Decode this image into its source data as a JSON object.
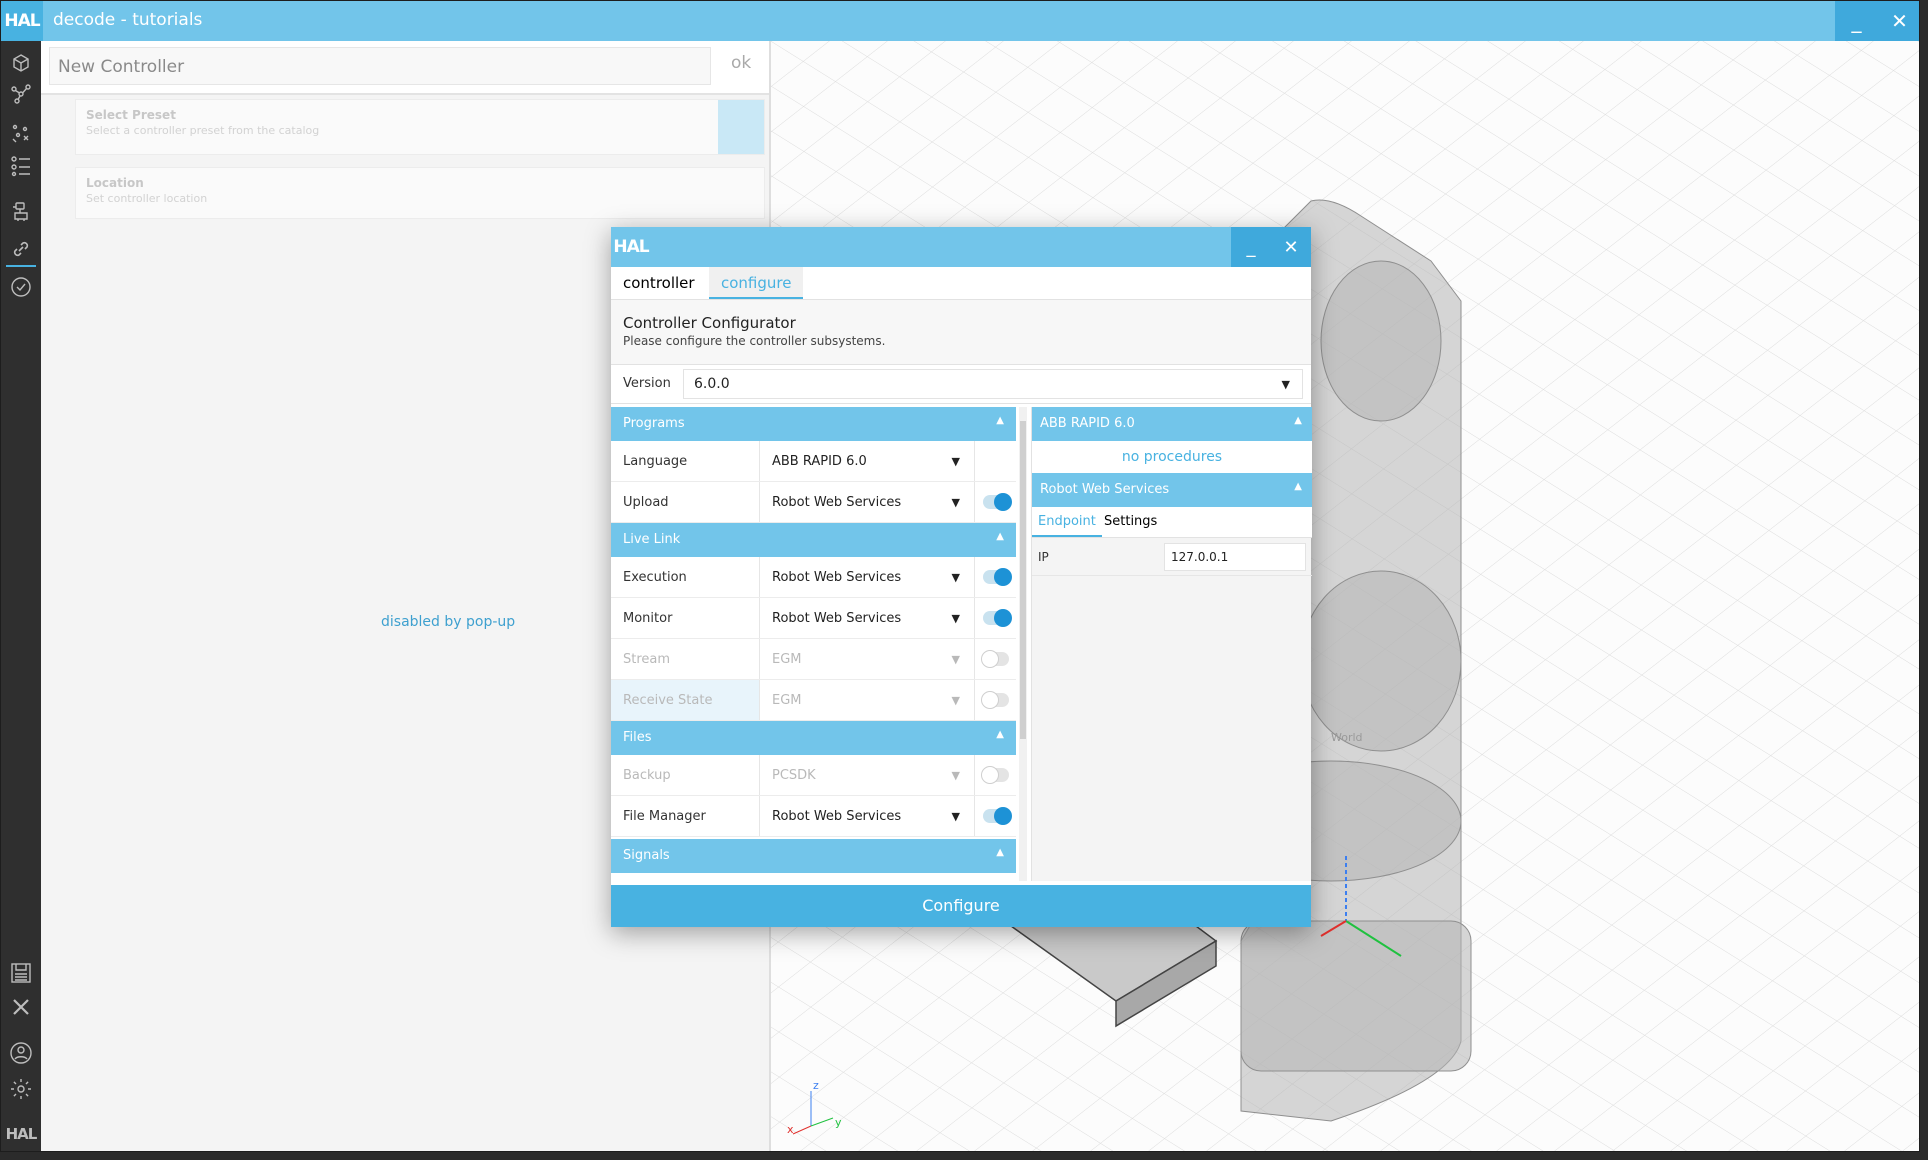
{
  "app": {
    "logo": "HAL",
    "title": "decode - tutorials",
    "minimize": "_",
    "close": "✕"
  },
  "sidebar": {
    "logo": "HAL",
    "icons": [
      "cube-icon",
      "graph-nodes-icon",
      "scatter-icon",
      "list-icon",
      "robot-icon",
      "link-icon",
      "check-circle-icon",
      "save-icon",
      "close-icon",
      "user-icon",
      "settings-icon"
    ]
  },
  "left_panel": {
    "name_placeholder": "New Controller",
    "ok_label": "ok",
    "cards": [
      {
        "title": "Select Preset",
        "subtitle": "Select a controller preset from the catalog"
      },
      {
        "title": "Location",
        "subtitle": "Set controller location"
      }
    ],
    "disabled_note": "disabled by pop-up"
  },
  "viewport": {
    "world_label": "World",
    "axis_z": "z",
    "axis_y": "y",
    "axis_x": "x"
  },
  "dialog": {
    "logo": "HAL",
    "minimize": "_",
    "close": "✕",
    "tabs": [
      "controller",
      "configure"
    ],
    "active_tab": "configure",
    "header_title": "Controller Configurator",
    "header_text": "Please configure the controller subsystems.",
    "version_label": "Version",
    "version_value": "6.0.0",
    "sections": {
      "programs": "Programs",
      "live_link": "Live Link",
      "files": "Files",
      "signals": "Signals"
    },
    "rows": {
      "language": {
        "label": "Language",
        "value": "ABB RAPID 6.0"
      },
      "upload": {
        "label": "Upload",
        "value": "Robot Web Services",
        "enabled": true
      },
      "execution": {
        "label": "Execution",
        "value": "Robot Web Services",
        "enabled": true
      },
      "monitor": {
        "label": "Monitor",
        "value": "Robot Web Services",
        "enabled": true
      },
      "stream": {
        "label": "Stream",
        "value": "EGM",
        "enabled": false
      },
      "receive_state": {
        "label": "Receive State",
        "value": "EGM",
        "enabled": false
      },
      "backup": {
        "label": "Backup",
        "value": "PCSDK",
        "enabled": false
      },
      "file_manager": {
        "label": "File Manager",
        "value": "Robot Web Services",
        "enabled": true
      }
    },
    "right": {
      "section1": "ABB RAPID 6.0",
      "no_procedures": "no procedures",
      "section2": "Robot Web Services",
      "tabs": [
        "Endpoint",
        "Settings"
      ],
      "active_tab": "Endpoint",
      "ip_label": "IP",
      "ip_value": "127.0.0.1"
    },
    "configure_label": "Configure"
  },
  "colors": {
    "accent": "#48b2e1",
    "title_bar": "#72c5ea",
    "toggle_on": "#1d92d6"
  }
}
